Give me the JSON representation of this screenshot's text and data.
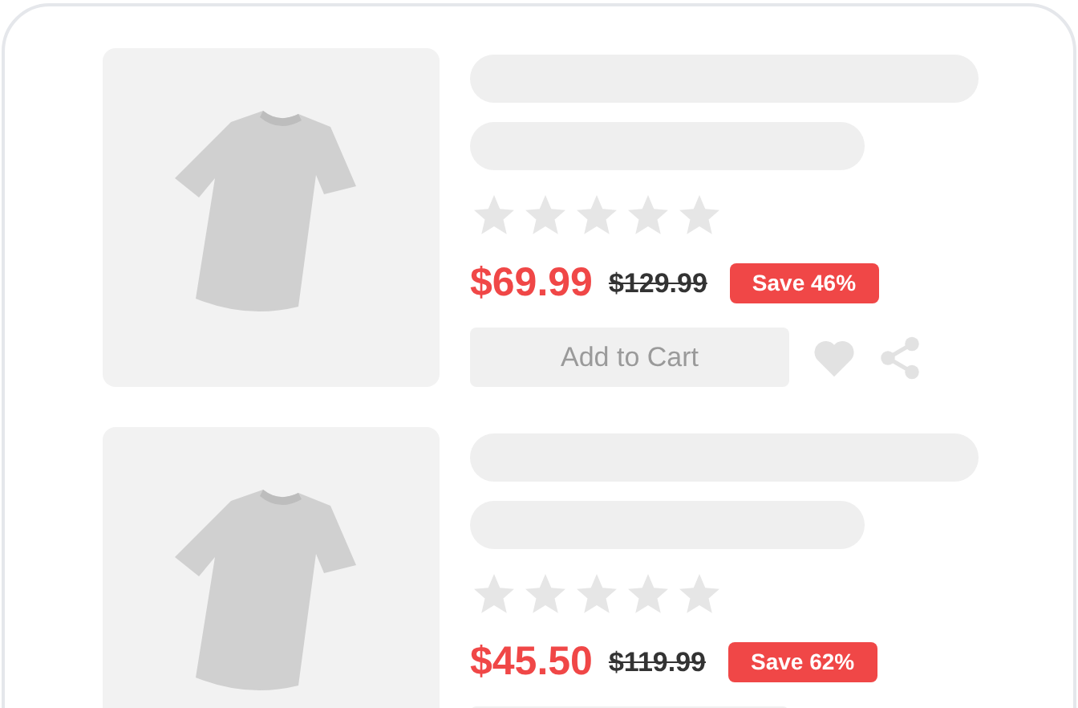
{
  "products": [
    {
      "stars": 0,
      "price": "$69.99",
      "old_price": "$129.99",
      "badge": "Save 46%",
      "button": "Add to Cart"
    },
    {
      "stars": 0,
      "price": "$45.50",
      "old_price": "$119.99",
      "badge": "Save 62%"
    }
  ]
}
